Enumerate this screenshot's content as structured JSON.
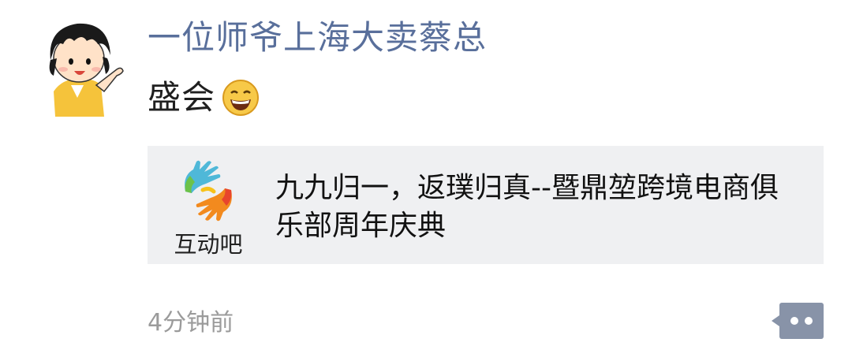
{
  "post": {
    "author": "一位师爷上海大卖蔡总",
    "text": "盛会",
    "emoji": "grinning-face-emoji",
    "time": "4分钟前"
  },
  "link_card": {
    "logo_text": "互动吧",
    "title": "九九归一，返璞归真--暨鼎堃跨境电商俱乐部周年庆典"
  },
  "colors": {
    "author": "#596f9b",
    "card_bg": "#eff0f2",
    "time": "#9b9b9b",
    "more_button": "#8893a8"
  }
}
